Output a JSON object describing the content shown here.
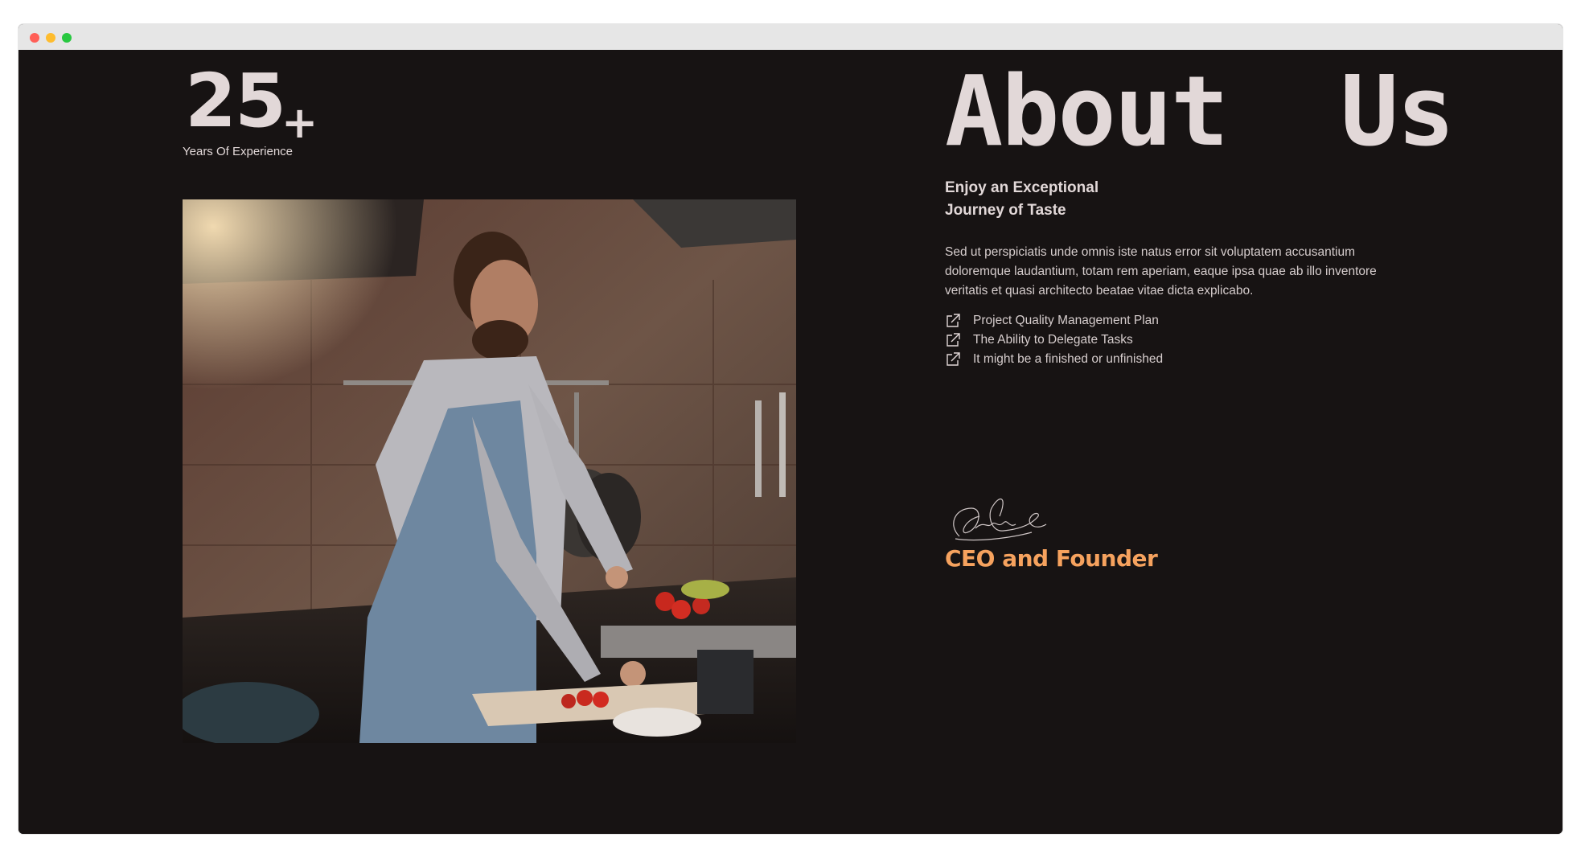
{
  "window": {
    "controls": [
      "close",
      "minimize",
      "maximize"
    ],
    "colors": {
      "close": "#ff5f57",
      "minimize": "#febc2e",
      "maximize": "#28c840",
      "background": "#171313",
      "accent": "#f6a25e",
      "text": "#e2d8d8"
    }
  },
  "experience": {
    "number": "25",
    "plus": "+",
    "caption": "Years Of Experience"
  },
  "photo": {
    "description_icon": "chef-photo"
  },
  "about": {
    "title": "About  Us",
    "subtitle_line1": "Enjoy an Exceptional",
    "subtitle_line2": "Journey of Taste",
    "body": "Sed ut perspiciatis unde omnis iste natus error sit voluptatem accusantium doloremque laudantium, totam rem aperiam, eaque ipsa quae ab illo inventore veritatis et quasi architecto beatae vitae dicta explicabo.",
    "features": [
      {
        "icon": "external-link-icon",
        "label": "Project Quality Management Plan"
      },
      {
        "icon": "external-link-icon",
        "label": "The Ability to Delegate Tasks"
      },
      {
        "icon": "external-link-icon",
        "label": "It might be a finished or unfinished"
      }
    ],
    "signature_icon": "signature",
    "role": "CEO and Founder"
  }
}
